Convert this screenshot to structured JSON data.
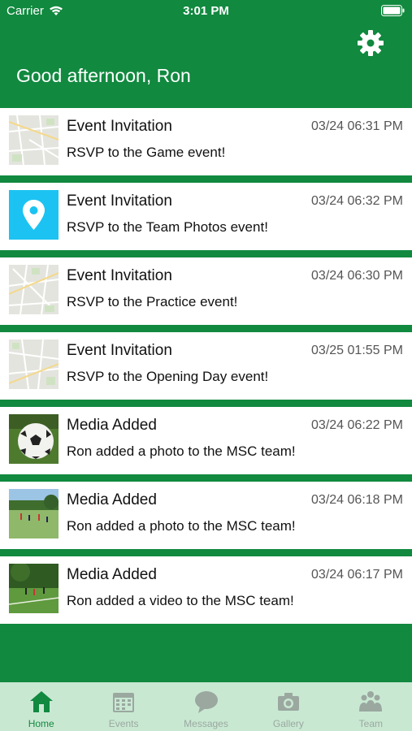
{
  "status_bar": {
    "carrier": "Carrier",
    "time": "3:01 PM"
  },
  "header": {
    "greeting": "Good afternoon, Ron",
    "settings_icon": "gear-icon"
  },
  "colors": {
    "brand_green": "#11893f",
    "tab_bar": "#c9e8d2",
    "location_tile": "#1cc3f2"
  },
  "feed": [
    {
      "title": "Event Invitation",
      "time": "03/24 06:31 PM",
      "body": "RSVP to the Game event!",
      "thumb": "map"
    },
    {
      "title": "Event Invitation",
      "time": "03/24 06:32 PM",
      "body": "RSVP to the Team Photos event!",
      "thumb": "location-pin"
    },
    {
      "title": "Event Invitation",
      "time": "03/24 06:30 PM",
      "body": "RSVP to the Practice event!",
      "thumb": "map"
    },
    {
      "title": "Event Invitation",
      "time": "03/25 01:55 PM",
      "body": "RSVP to the Opening Day event!",
      "thumb": "map"
    },
    {
      "title": "Media Added",
      "time": "03/24 06:22 PM",
      "body": "Ron added a photo to the MSC team!",
      "thumb": "soccer-ball-photo"
    },
    {
      "title": "Media Added",
      "time": "03/24 06:18 PM",
      "body": "Ron added a photo to the MSC team!",
      "thumb": "field-photo"
    },
    {
      "title": "Media Added",
      "time": "03/24 06:17 PM",
      "body": "Ron added a video to the MSC team!",
      "thumb": "field-photo"
    }
  ],
  "tabs": [
    {
      "label": "Home",
      "icon": "home-icon",
      "active": true
    },
    {
      "label": "Events",
      "icon": "calendar-icon",
      "active": false
    },
    {
      "label": "Messages",
      "icon": "chat-bubble-icon",
      "active": false
    },
    {
      "label": "Gallery",
      "icon": "camera-icon",
      "active": false
    },
    {
      "label": "Team",
      "icon": "team-icon",
      "active": false
    }
  ]
}
